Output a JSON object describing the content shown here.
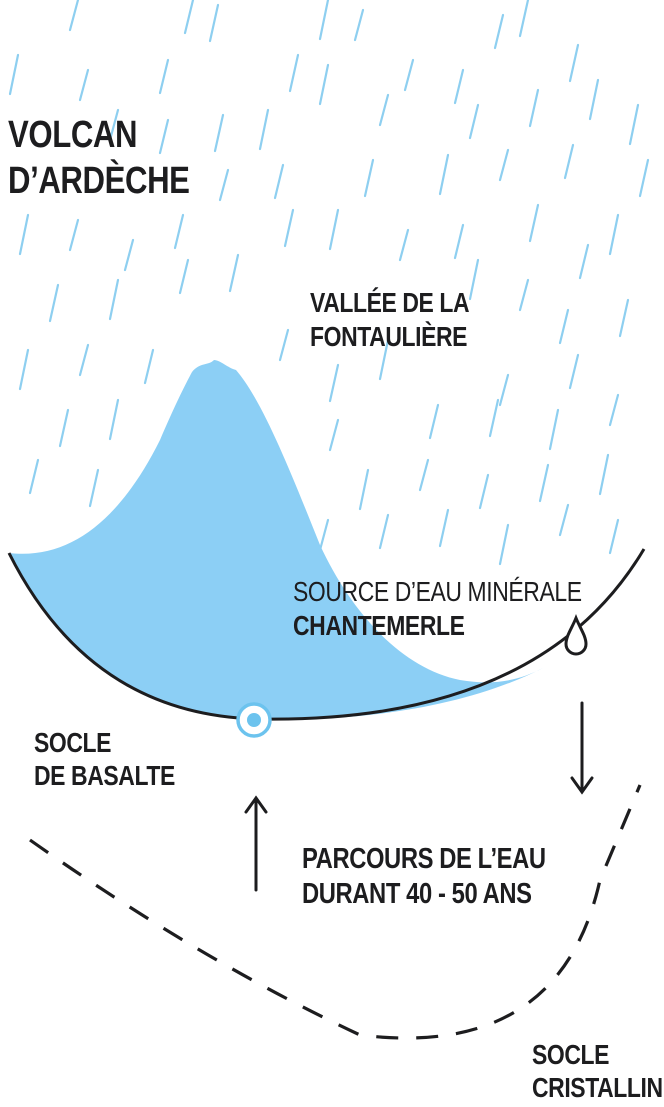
{
  "title": {
    "line1": "VOLCAN",
    "line2": "D’ARDÈCHE"
  },
  "valley": {
    "line1": "VALLÉE DE LA",
    "line2": "FONTAULIÈRE"
  },
  "spring": {
    "line1": "SOURCE D’EAU MINÉRALE",
    "line2": "CHANTEMERLE"
  },
  "basalt": {
    "line1": "SOCLE",
    "line2": "DE BASALTE"
  },
  "water_path": {
    "line1": "PARCOURS DE L’EAU",
    "line2": "DURANT 40 - 50 ANS"
  },
  "crystalline": {
    "line1": "SOCLE",
    "line2": "CRISTALLIN"
  },
  "colors": {
    "rain": "#8ecff0",
    "volcano": "#8ccff5",
    "ink": "#1d1d1f",
    "spring_ring": "#6cc3ee"
  }
}
